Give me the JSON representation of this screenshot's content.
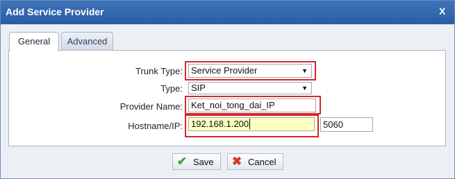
{
  "dialog": {
    "title": "Add Service Provider",
    "close_label": "X"
  },
  "tabs": [
    {
      "label": "General",
      "active": true
    },
    {
      "label": "Advanced",
      "active": false
    }
  ],
  "form": {
    "trunk_type": {
      "label": "Trunk Type:",
      "value": "Service Provider"
    },
    "type": {
      "label": "Type:",
      "value": "SIP"
    },
    "provider_name": {
      "label": "Provider Name:",
      "value": "Ket_noi_tong_dai_IP"
    },
    "hostname": {
      "label": "Hostname/IP:",
      "value": "192.168.1.200",
      "port": "5060",
      "separator": ":"
    }
  },
  "buttons": {
    "save": "Save",
    "cancel": "Cancel"
  },
  "colors": {
    "titlebar": "#285ea6",
    "highlight_border": "#d6262c",
    "focused_field_bg": "#ffffc0",
    "save_icon": "#3aa637",
    "cancel_icon": "#d63a2a"
  },
  "icons": {
    "arrow": "chevron-down-icon",
    "save": "check-icon",
    "cancel": "x-icon"
  }
}
